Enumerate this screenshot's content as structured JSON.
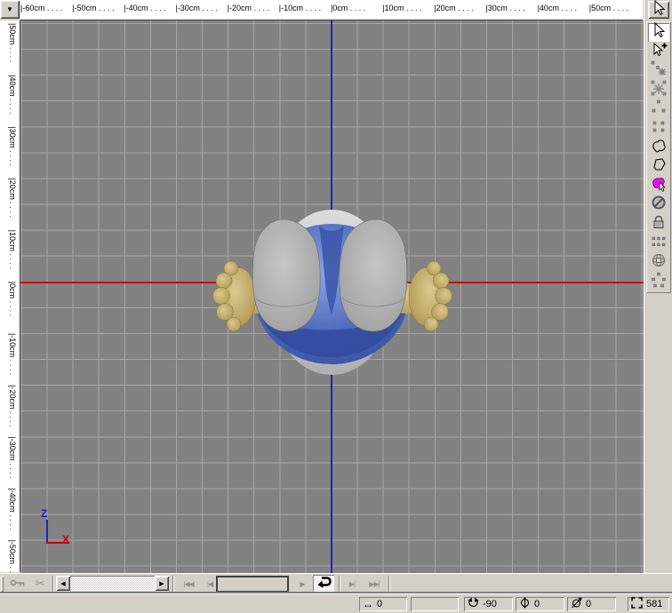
{
  "corner": {
    "dropdown_icon": "▼"
  },
  "rulers": {
    "unit": "cm",
    "horizontal": [
      "-60cm",
      "-50cm",
      "-40cm",
      "-30cm",
      "-20cm",
      "-10cm",
      "0cm",
      "10cm",
      "20cm",
      "30cm",
      "40cm",
      "50cm"
    ],
    "vertical": [
      "50cm",
      "40cm",
      "30cm",
      "20cm",
      "10cm",
      "0cm",
      "-10cm",
      "-20cm",
      "-30cm",
      "-40cm",
      "-50cm"
    ],
    "tick_dots": " .  .  .  . "
  },
  "viewport": {
    "bg": "#828282",
    "grid_color": "#a8a8a8",
    "x_axis_color": "#cc0000",
    "y_axis_color": "#2323bb"
  },
  "axis_indicator": {
    "z_label": "Z",
    "x_label": "X"
  },
  "scene": {
    "description": "Top view of a 3D cartoon character: blue spherical body, silver inner sphere, two gray feet, tan hands",
    "sphere_light": "#dcdcdc",
    "sphere_dark": "#b0b0b0",
    "body_light": "#8aa4e4",
    "body_mid": "#4a67bb",
    "body_dark": "#35509f",
    "feet_light": "#c6c6c6",
    "feet_dark": "#9a9a9a",
    "hand_light": "#dcc98c",
    "hand_dark": "#a8924e"
  },
  "right_toolbar": {
    "top_button": {
      "name": "pointer-tool",
      "icon": "cursor"
    },
    "buttons": [
      {
        "name": "select-tool",
        "icon": "cursor",
        "active": true
      },
      {
        "name": "select-add-tool",
        "icon": "cursor-plus",
        "active": false
      },
      {
        "name": "drag-select-tool",
        "icon": "drag-select",
        "active": false
      },
      {
        "name": "select-connected-tool",
        "icon": "asterisk",
        "active": false
      },
      {
        "name": "point-mode-tool",
        "icon": "dots-tri",
        "active": false
      },
      {
        "name": "edge-mode-tool",
        "icon": "dots-quad",
        "active": false
      },
      {
        "name": "lasso-tool",
        "icon": "lasso",
        "active": false
      },
      {
        "name": "polygon-lasso-tool",
        "icon": "polygon",
        "active": false
      },
      {
        "name": "paint-select-tool",
        "icon": "paint-blob",
        "active": false
      },
      {
        "name": "hide-tool",
        "icon": "circle-slash",
        "active": false
      },
      {
        "name": "lock-tool",
        "icon": "lock",
        "active": false
      },
      {
        "name": "edge-rows-tool",
        "icon": "dots-rows",
        "active": false
      },
      {
        "name": "wire-sphere-tool",
        "icon": "wire-sphere",
        "active": false
      },
      {
        "name": "vertices-tool",
        "icon": "dots-penta",
        "active": false
      }
    ]
  },
  "timeline": {
    "scroll_left": "◀",
    "scroll_right": "▶",
    "first": "|◀◀",
    "prev": "|◀",
    "play": "▶",
    "next": "▶|",
    "last": "▶▶|",
    "frame_value": "",
    "loop_active": true
  },
  "status_bar": {
    "fields": [
      {
        "name": "pan-x",
        "icon": "pan",
        "value": "0"
      },
      {
        "name": "blank",
        "icon": "",
        "value": ""
      },
      {
        "name": "rotate-y",
        "icon": "rot-y",
        "value": "-90"
      },
      {
        "name": "rotate-x",
        "icon": "rot-x",
        "value": "0"
      },
      {
        "name": "rotate-z",
        "icon": "rot-z",
        "value": "0"
      },
      {
        "name": "zoom",
        "icon": "zoom4",
        "value": "581"
      }
    ]
  },
  "colors": {
    "chrome": "#d4d0c8",
    "ruler_bg": "#ffffff",
    "ruler_text": "#000000"
  }
}
